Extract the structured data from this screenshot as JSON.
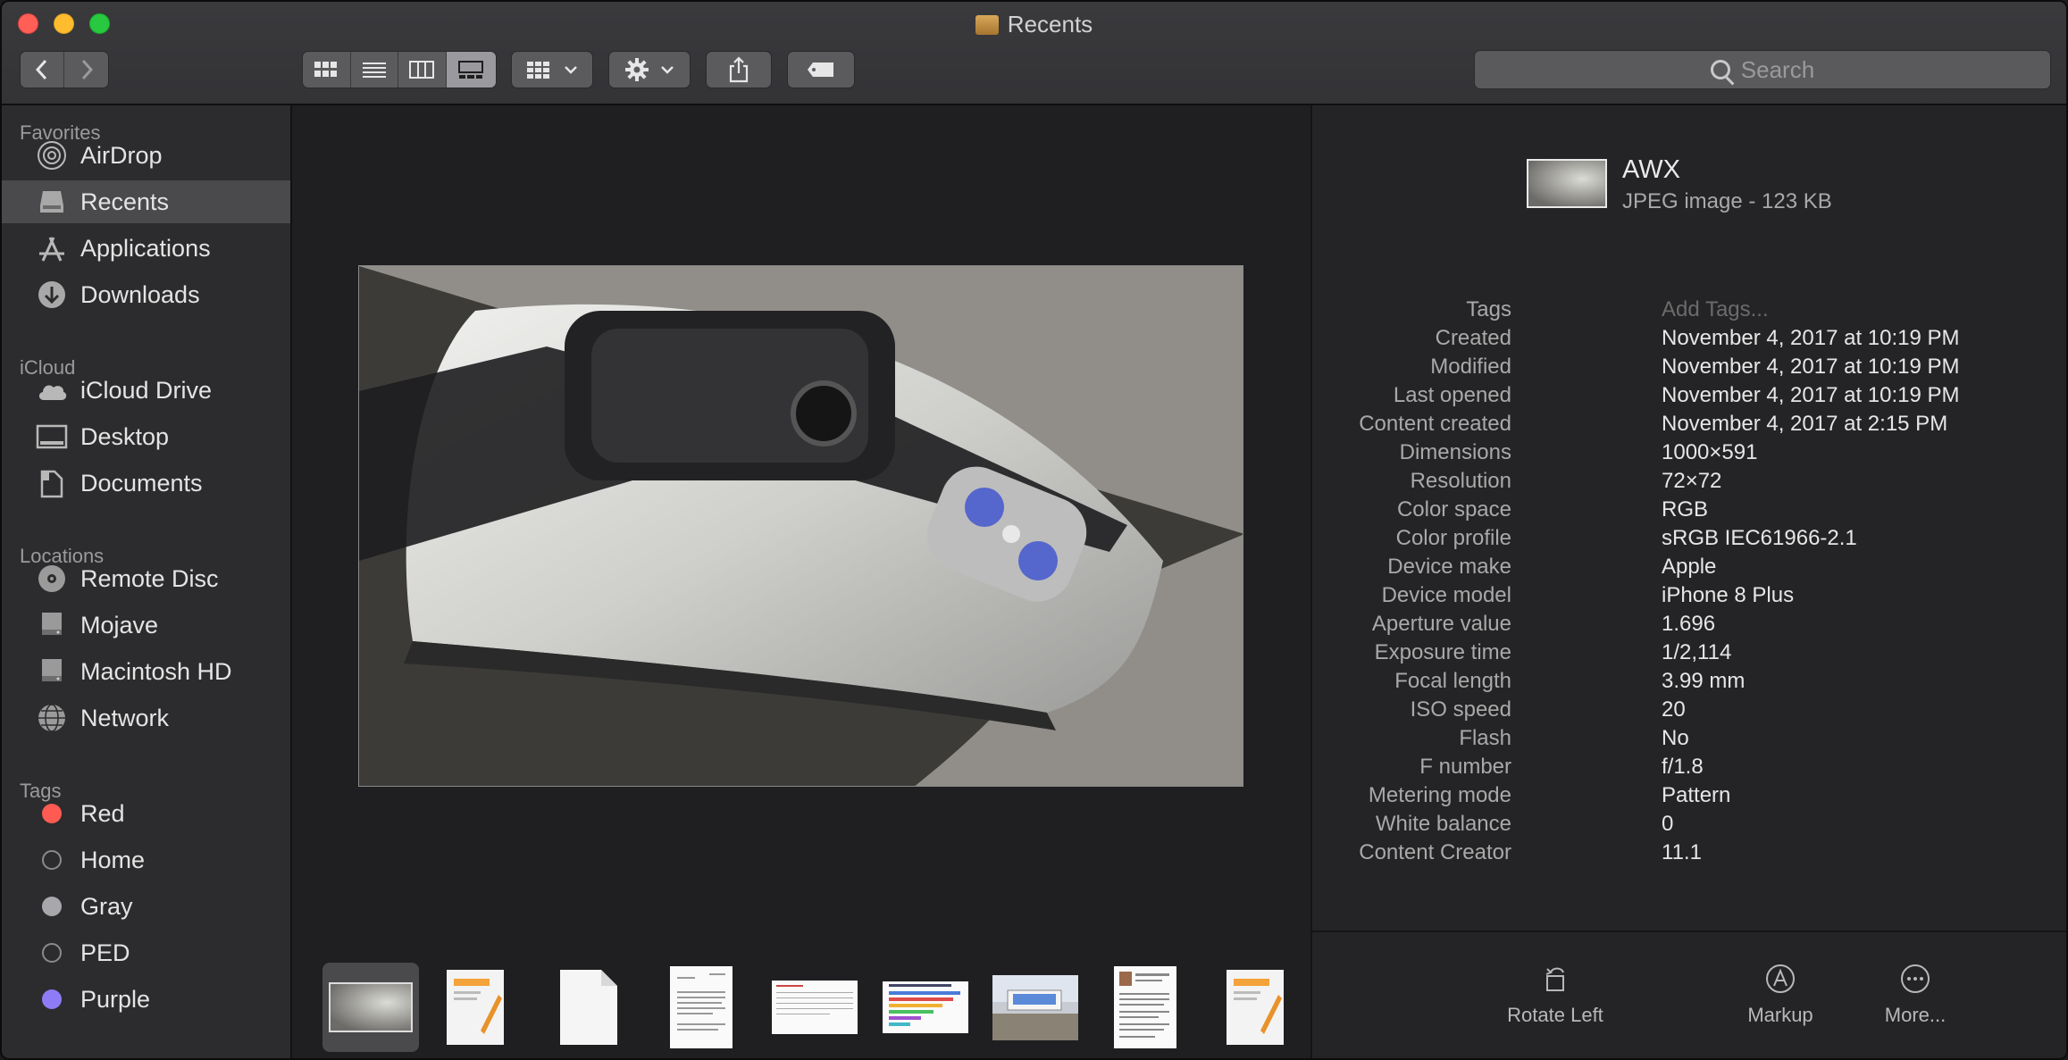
{
  "window": {
    "title": "Recents"
  },
  "toolbar": {
    "search_placeholder": "Search"
  },
  "sidebar": {
    "sections": [
      {
        "label": "Favorites",
        "items": [
          {
            "label": "AirDrop",
            "icon": "airdrop-icon"
          },
          {
            "label": "Recents",
            "icon": "recents-icon",
            "selected": true
          },
          {
            "label": "Applications",
            "icon": "applications-icon"
          },
          {
            "label": "Downloads",
            "icon": "downloads-icon"
          }
        ]
      },
      {
        "label": "iCloud",
        "items": [
          {
            "label": "iCloud Drive",
            "icon": "cloud-icon"
          },
          {
            "label": "Desktop",
            "icon": "desktop-icon"
          },
          {
            "label": "Documents",
            "icon": "documents-icon"
          }
        ]
      },
      {
        "label": "Locations",
        "items": [
          {
            "label": "Remote Disc",
            "icon": "disc-icon"
          },
          {
            "label": "Mojave",
            "icon": "drive-icon"
          },
          {
            "label": "Macintosh HD",
            "icon": "drive-icon"
          },
          {
            "label": "Network",
            "icon": "network-icon"
          }
        ]
      },
      {
        "label": "Tags",
        "items": [
          {
            "label": "Red",
            "color": "#ff5b52"
          },
          {
            "label": "Home",
            "color": "none"
          },
          {
            "label": "Gray",
            "color": "#a8a8ac"
          },
          {
            "label": "PED",
            "color": "none"
          },
          {
            "label": "Purple",
            "color": "#8e7cf6"
          }
        ]
      }
    ]
  },
  "inspector": {
    "name": "AWX",
    "kind": "JPEG image - 123 KB",
    "rows": [
      {
        "key": "Tags",
        "value": "Add Tags..."
      },
      {
        "key": "Created",
        "value": "November 4, 2017 at 10:19 PM"
      },
      {
        "key": "Modified",
        "value": "November 4, 2017 at 10:19 PM"
      },
      {
        "key": "Last opened",
        "value": "November 4, 2017 at 10:19 PM"
      },
      {
        "key": "Content created",
        "value": "November 4, 2017 at 2:15 PM"
      },
      {
        "key": "Dimensions",
        "value": "1000×591"
      },
      {
        "key": "Resolution",
        "value": "72×72"
      },
      {
        "key": "Color space",
        "value": "RGB"
      },
      {
        "key": "Color profile",
        "value": "sRGB IEC61966-2.1"
      },
      {
        "key": "Device make",
        "value": "Apple"
      },
      {
        "key": "Device model",
        "value": "iPhone 8 Plus"
      },
      {
        "key": "Aperture value",
        "value": "1.696"
      },
      {
        "key": "Exposure time",
        "value": "1/2,114"
      },
      {
        "key": "Focal length",
        "value": "3.99 mm"
      },
      {
        "key": "ISO speed",
        "value": "20"
      },
      {
        "key": "Flash",
        "value": "No"
      },
      {
        "key": "F number",
        "value": "f/1.8"
      },
      {
        "key": "Metering mode",
        "value": "Pattern"
      },
      {
        "key": "White balance",
        "value": "0"
      },
      {
        "key": "Content Creator",
        "value": "11.1"
      }
    ],
    "actions": [
      {
        "label": "Rotate Left",
        "icon": "rotate-left-icon"
      },
      {
        "label": "Markup",
        "icon": "markup-icon"
      },
      {
        "label": "More...",
        "icon": "more-icon"
      }
    ]
  }
}
